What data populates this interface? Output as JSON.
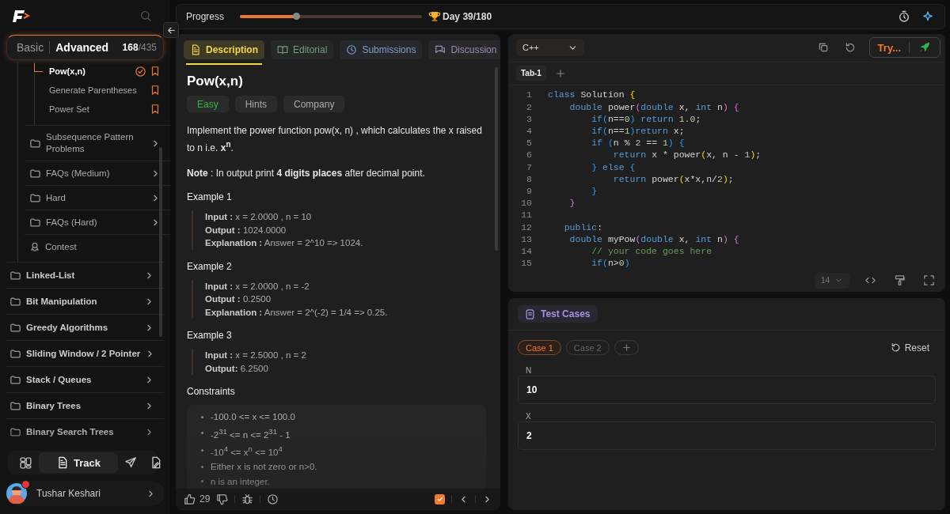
{
  "sidebar": {
    "modes": [
      {
        "label": "Basic",
        "selected": false
      },
      {
        "label": "Advanced",
        "selected": true
      }
    ],
    "solved_count": "168",
    "total_count": "/435",
    "topics": [
      {
        "label": "Pow(x,n)",
        "selected": true,
        "solved": true
      },
      {
        "label": "Generate Parentheses",
        "selected": false,
        "solved": false
      },
      {
        "label": "Power Set",
        "selected": false,
        "solved": false
      }
    ],
    "subsections": [
      {
        "label": "Subsequence Pattern Problems",
        "kind": "folder"
      },
      {
        "label": "FAQs (Medium)",
        "kind": "folder"
      },
      {
        "label": "Hard",
        "kind": "folder"
      },
      {
        "label": "FAQs (Hard)",
        "kind": "folder"
      },
      {
        "label": "Contest",
        "kind": "contest"
      }
    ],
    "sections": [
      {
        "label": "Linked-List"
      },
      {
        "label": "Bit Manipulation"
      },
      {
        "label": "Greedy Algorithms"
      },
      {
        "label": "Sliding Window / 2 Pointer"
      },
      {
        "label": "Stack / Queues"
      },
      {
        "label": "Binary Trees"
      },
      {
        "label": "Binary Search Trees"
      }
    ],
    "nav": [
      {
        "kind": "grid",
        "selected": false
      },
      {
        "kind": "track",
        "label": "Track",
        "selected": true
      },
      {
        "kind": "send",
        "selected": false
      },
      {
        "kind": "file",
        "selected": false
      }
    ],
    "user": {
      "name": "Tushar Keshari",
      "notification": true
    }
  },
  "progress": {
    "label": "Progress",
    "level": 0.31,
    "day": "Day 39/180"
  },
  "problem": {
    "tabs": [
      {
        "label": "Description",
        "selected": true,
        "color": "#f2d64b"
      },
      {
        "label": "Editorial",
        "selected": false,
        "color": "#6f9f7c"
      },
      {
        "label": "Submissions",
        "selected": false,
        "color": "#7f9cc9"
      },
      {
        "label": "Discussion",
        "selected": false,
        "color": "#9d8ab8"
      }
    ],
    "title": "Pow(x,n)",
    "tags": [
      {
        "label": "Easy",
        "kind": "difficulty"
      },
      {
        "label": "Hints",
        "kind": "button"
      },
      {
        "label": "Company",
        "kind": "button"
      }
    ],
    "paragraphs": [
      "Implement the power function pow(x, n) , which calculates the x raised to n i.e. **x$^{n}$**.",
      "**Note** : In output print **4 digits places** after decimal point."
    ],
    "examples": [
      {
        "title": "Example 1",
        "lines": [
          "**Input :** x = 2.0000 , n = 10",
          "**Output :** 1024.0000",
          "**Explanation :** Answer = 2^10 => 1024."
        ]
      },
      {
        "title": "Example 2",
        "lines": [
          "**Input :** x = 2.0000 , n = -2",
          "**Output :** 0.2500",
          "**Explanation :** Answer = 2^(-2) = 1/4 => 0.25."
        ]
      },
      {
        "title": "Example 3",
        "lines": [
          "**Input :** x = 2.5000 , n = 2",
          "**Output:**  6.2500"
        ]
      }
    ],
    "constraints_title": "Constraints",
    "constraints": [
      "-100.0 <= x <= 100.0",
      "-2$^{31}$ <= n <= 2$^{31}$ - 1",
      "-10$^{4}$ <= x$^{n}$ <= 10$^{4}$",
      "Either x is not zero or n>0.",
      "n is an integer."
    ],
    "footer": {
      "likes": "29",
      "marked": true
    }
  },
  "editor": {
    "language": "C++",
    "run_label": "Try...",
    "tabs": [
      {
        "label": "Tab-1",
        "selected": true
      }
    ],
    "font_size": "14",
    "lines": [
      {
        "number": "1",
        "tokens": [
          {
            "text": "class",
            "kind": "kw"
          },
          {
            "text": " Solution ",
            "kind": "pl"
          },
          {
            "text": "{",
            "kind": "b1"
          }
        ]
      },
      {
        "number": "2",
        "tokens": [
          {
            "text": "    double",
            "kind": "kw"
          },
          {
            "text": " power",
            "kind": "pl"
          },
          {
            "text": "(",
            "kind": "b2"
          },
          {
            "text": "double",
            "kind": "kw"
          },
          {
            "text": " x, ",
            "kind": "pl"
          },
          {
            "text": "int",
            "kind": "kw"
          },
          {
            "text": " n",
            "kind": "pl"
          },
          {
            "text": ") {",
            "kind": "b2"
          }
        ]
      },
      {
        "number": "3",
        "tokens": [
          {
            "text": "        if",
            "kind": "kw"
          },
          {
            "text": "(",
            "kind": "b3"
          },
          {
            "text": "n==",
            "kind": "pl"
          },
          {
            "text": "0",
            "kind": "num"
          },
          {
            "text": ")",
            "kind": "b3"
          },
          {
            "text": " return",
            "kind": "kw"
          },
          {
            "text": " 1.0",
            "kind": "num"
          },
          {
            "text": ";",
            "kind": "pl"
          }
        ]
      },
      {
        "number": "4",
        "tokens": [
          {
            "text": "        if",
            "kind": "kw"
          },
          {
            "text": "(",
            "kind": "b3"
          },
          {
            "text": "n==",
            "kind": "pl"
          },
          {
            "text": "1",
            "kind": "num"
          },
          {
            "text": ")",
            "kind": "b3"
          },
          {
            "text": "return",
            "kind": "kw"
          },
          {
            "text": " x;",
            "kind": "pl"
          }
        ]
      },
      {
        "number": "5",
        "tokens": [
          {
            "text": "        if",
            "kind": "kw"
          },
          {
            "text": " (",
            "kind": "b3"
          },
          {
            "text": "n % ",
            "kind": "pl"
          },
          {
            "text": "2",
            "kind": "num"
          },
          {
            "text": " == ",
            "kind": "pl"
          },
          {
            "text": "1",
            "kind": "num"
          },
          {
            "text": ") {",
            "kind": "b3"
          }
        ]
      },
      {
        "number": "6",
        "tokens": [
          {
            "text": "            return",
            "kind": "kw"
          },
          {
            "text": " x * power",
            "kind": "pl"
          },
          {
            "text": "(",
            "kind": "b1"
          },
          {
            "text": "x, n - ",
            "kind": "pl"
          },
          {
            "text": "1",
            "kind": "num"
          },
          {
            "text": ")",
            "kind": "b1"
          },
          {
            "text": ";",
            "kind": "pl"
          }
        ]
      },
      {
        "number": "7",
        "tokens": [
          {
            "text": "        }",
            "kind": "b3"
          },
          {
            "text": " else",
            "kind": "kw"
          },
          {
            "text": " {",
            "kind": "b3"
          }
        ]
      },
      {
        "number": "8",
        "tokens": [
          {
            "text": "            return",
            "kind": "kw"
          },
          {
            "text": " power",
            "kind": "pl"
          },
          {
            "text": "(",
            "kind": "b1"
          },
          {
            "text": "x*x,n/",
            "kind": "pl"
          },
          {
            "text": "2",
            "kind": "num"
          },
          {
            "text": ")",
            "kind": "b1"
          },
          {
            "text": ";",
            "kind": "pl"
          }
        ]
      },
      {
        "number": "9",
        "tokens": [
          {
            "text": "        }",
            "kind": "b3"
          }
        ]
      },
      {
        "number": "10",
        "tokens": [
          {
            "text": "    }",
            "kind": "b2"
          }
        ]
      },
      {
        "number": "11"
      },
      {
        "number": "12",
        "tokens": [
          {
            "text": "   public",
            "kind": "kw"
          },
          {
            "text": ":",
            "kind": "pl"
          }
        ]
      },
      {
        "number": "13",
        "tokens": [
          {
            "text": "    double",
            "kind": "kw"
          },
          {
            "text": " myPow",
            "kind": "pl"
          },
          {
            "text": "(",
            "kind": "b2"
          },
          {
            "text": "double",
            "kind": "kw"
          },
          {
            "text": " x, ",
            "kind": "pl"
          },
          {
            "text": "int",
            "kind": "kw"
          },
          {
            "text": " n",
            "kind": "pl"
          },
          {
            "text": ") {",
            "kind": "b2"
          }
        ]
      },
      {
        "number": "14",
        "tokens": [
          {
            "text": "        // your code goes here",
            "kind": "com"
          }
        ]
      },
      {
        "number": "15",
        "tokens": [
          {
            "text": "        if",
            "kind": "kw"
          },
          {
            "text": "(",
            "kind": "b3"
          },
          {
            "text": "n>",
            "kind": "pl"
          },
          {
            "text": "0",
            "kind": "num"
          },
          {
            "text": ")",
            "kind": "b3"
          }
        ]
      }
    ]
  },
  "tests": {
    "tab": "Test Cases",
    "cases": [
      {
        "label": "Case 1",
        "selected": true
      },
      {
        "label": "Case 2",
        "selected": false
      }
    ],
    "reset": "Reset",
    "inputs": [
      {
        "label": "N",
        "value": "10"
      },
      {
        "label": "X",
        "value": "2"
      }
    ]
  }
}
